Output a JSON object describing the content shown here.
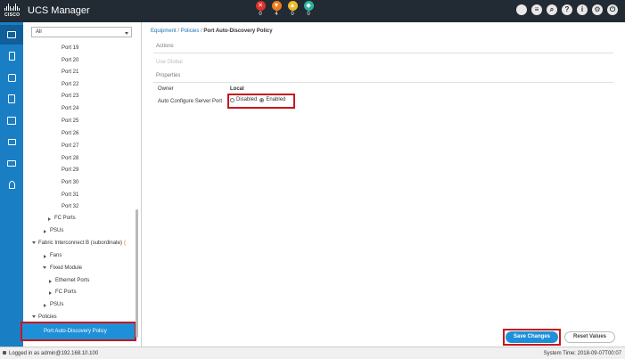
{
  "header": {
    "brand": "CISCO",
    "app_title": "UCS Manager",
    "faults": [
      {
        "icon": "critical-fault-icon",
        "glyph": "✕",
        "color": "#e0312b",
        "count": "0"
      },
      {
        "icon": "major-fault-icon",
        "glyph": "▼",
        "color": "#f07b1d",
        "count": "4"
      },
      {
        "icon": "minor-fault-icon",
        "glyph": "▲",
        "color": "#f2b92a",
        "count": "0"
      },
      {
        "icon": "warning-fault-icon",
        "glyph": "◆",
        "color": "#2bb3a0",
        "count": "0"
      }
    ],
    "toolbar_icons": [
      "status-icon",
      "menu-icon",
      "search-icon",
      "help-icon",
      "info-icon",
      "settings-icon",
      "exit-icon"
    ],
    "toolbar_glyphs": [
      "",
      "≡",
      "⌕",
      "?",
      "i",
      "⚙",
      "⏻"
    ]
  },
  "nav": {
    "items": [
      "equipment-icon",
      "servers-icon",
      "lan-icon",
      "san-icon",
      "vm-icon",
      "storage-icon",
      "chassis-icon",
      "admin-icon"
    ]
  },
  "tree": {
    "filter_value": "All",
    "ports": [
      "Port 19",
      "Port 20",
      "Port 21",
      "Port 22",
      "Port 23",
      "Port 24",
      "Port 25",
      "Port 26",
      "Port 27",
      "Port 28",
      "Port 29",
      "Port 30",
      "Port 31",
      "Port 32"
    ],
    "fc_ports_a": "FC Ports",
    "psus_a": "PSUs",
    "fi_b": "Fabric Interconnect B (subordinate)",
    "fans": "Fans",
    "fixed_module": "Fixed Module",
    "ethernet_ports": "Ethernet Ports",
    "fc_ports_b": "FC Ports",
    "psus_b": "PSUs",
    "policies": "Policies",
    "selected": "Port Auto-Discovery Policy"
  },
  "breadcrumb": {
    "part1": "Equipment",
    "sep": "/",
    "part2": "Policies",
    "current": "Port Auto-Discovery Policy"
  },
  "content": {
    "actions_label": "Actions",
    "use_global": "Use Global",
    "properties_label": "Properties",
    "owner_label": "Owner",
    "owner_value": "Local",
    "auto_config_label": "Auto Configure Server Port",
    "radio_disabled": "Disabled",
    "radio_enabled": "Enabled",
    "selected_option": "Enabled"
  },
  "buttons": {
    "save": "Save Changes",
    "reset": "Reset Values"
  },
  "status": {
    "logged_in": "Logged in as admin@192.168.10.100",
    "system_time": "System Time: 2018-09-07T00:07"
  }
}
